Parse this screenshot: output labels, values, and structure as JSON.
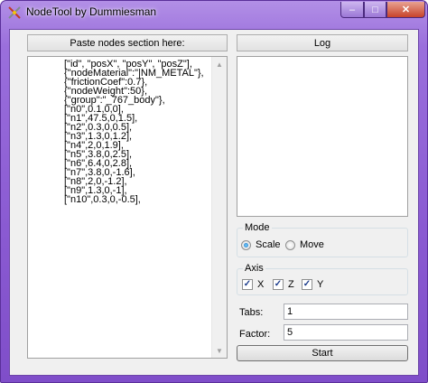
{
  "window": {
    "title": "NodeTool by Dummiesman",
    "minimize_glyph": "–",
    "maximize_glyph": "□",
    "close_glyph": "✕"
  },
  "colors": {
    "frame": "#8a5ad2",
    "close_button": "#c7432a",
    "radio_dot": "#1b6fc1"
  },
  "left_panel": {
    "header": "Paste nodes section here:",
    "lines": [
      "[\"id\", \"posX\", \"posY\", \"posZ\"],",
      "{\"nodeMaterial\":\"|NM_METAL\"},",
      "{\"frictionCoef\":0.7},",
      "{\"nodeWeight\":50},",
      "{\"group\":\"_767_body\"},",
      "[\"n0\",0.1,0,0],",
      "[\"n1\",47.5,0,1.5],",
      "[\"n2\",0.3,0,0.5],",
      "[\"n3\",1.3,0,1.2],",
      "[\"n4\",2,0,1.9],",
      "[\"n5\",3.8,0,2.5],",
      "[\"n6\",6.4,0,2.8],",
      "[\"n7\",3.8,0,-1.6],",
      "[\"n8\",2,0,-1.2],",
      "[\"n9\",1.3,0,-1],",
      "[\"n10\",0.3,0,-0.5],"
    ],
    "scroll_up_icon": "up-arrow",
    "scroll_down_icon": "down-arrow"
  },
  "right_panel": {
    "header": "Log",
    "log_text": "",
    "mode": {
      "title": "Mode",
      "options": [
        "Scale",
        "Move"
      ],
      "selected": "Scale"
    },
    "axis": {
      "title": "Axis",
      "items": [
        {
          "label": "X",
          "checked": true
        },
        {
          "label": "Z",
          "checked": true
        },
        {
          "label": "Y",
          "checked": true
        }
      ]
    },
    "tabs": {
      "label": "Tabs:",
      "value": "1"
    },
    "factor": {
      "label": "Factor:",
      "value": "5"
    },
    "start_button": "Start"
  }
}
